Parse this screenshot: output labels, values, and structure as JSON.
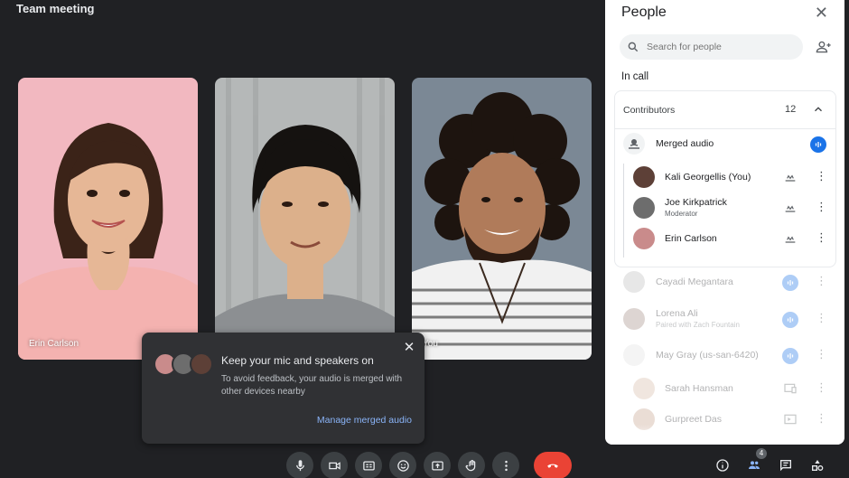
{
  "meeting": {
    "title": "Team meeting"
  },
  "tiles": [
    {
      "name": "Erin Carlson",
      "bg": "#f2b8c0",
      "skin": "#e6b796",
      "hair": "#3b2318",
      "shirt": "#f4b2b0"
    },
    {
      "name": "",
      "bg": "#b5b8b8",
      "skin": "#dcb08b",
      "hair": "#151210",
      "shirt": "#8c8f92"
    },
    {
      "name": "You",
      "bg": "#7b8895",
      "skin": "#b07b5a",
      "hair": "#1d140f",
      "shirt": "#f1f1f1"
    }
  ],
  "popup": {
    "title": "Keep your mic and speakers on",
    "body": "To avoid feedback, your audio is merged with other devices nearby",
    "link": "Manage merged audio",
    "close_icon": "close-icon"
  },
  "controls": [
    {
      "name": "microphone-icon"
    },
    {
      "name": "camera-icon"
    },
    {
      "name": "captions-icon"
    },
    {
      "name": "emoji-icon"
    },
    {
      "name": "present-screen-icon"
    },
    {
      "name": "raise-hand-icon"
    },
    {
      "name": "more-options-icon"
    },
    {
      "name": "hang-up-icon"
    }
  ],
  "right_controls": {
    "people_badge": "4",
    "icons": [
      "info-icon",
      "people-icon",
      "chat-icon",
      "activities-icon"
    ]
  },
  "people_panel": {
    "title": "People",
    "search_placeholder": "Search for people",
    "in_call_label": "In call",
    "contributors_label": "Contributors",
    "contributors_count": "12",
    "merged_label": "Merged audio",
    "merged_members": [
      {
        "name": "Kali Georgellis (You)",
        "sub": "",
        "avatar_color": "#5d4037"
      },
      {
        "name": "Joe Kirkpatrick",
        "sub": "Moderator",
        "avatar_color": "#6d6d6d"
      },
      {
        "name": "Erin Carlson",
        "sub": "",
        "avatar_color": "#c98b8b"
      }
    ],
    "others": [
      {
        "name": "Cayadi Megantara",
        "sub": "",
        "device": "audio"
      },
      {
        "name": "Lorena Ali",
        "sub": "Paired with  Zach Fountain",
        "device": "audio"
      },
      {
        "name": "May Gray (us-san-6420)",
        "sub": "",
        "device": "audio"
      },
      {
        "name": "Sarah Hansman",
        "sub": "",
        "device": "cast"
      },
      {
        "name": "Gurpreet Das",
        "sub": "",
        "device": "present"
      }
    ]
  },
  "colors": {
    "accent": "#1a73e8",
    "hangup": "#ea4335",
    "link": "#8ab4f8"
  }
}
